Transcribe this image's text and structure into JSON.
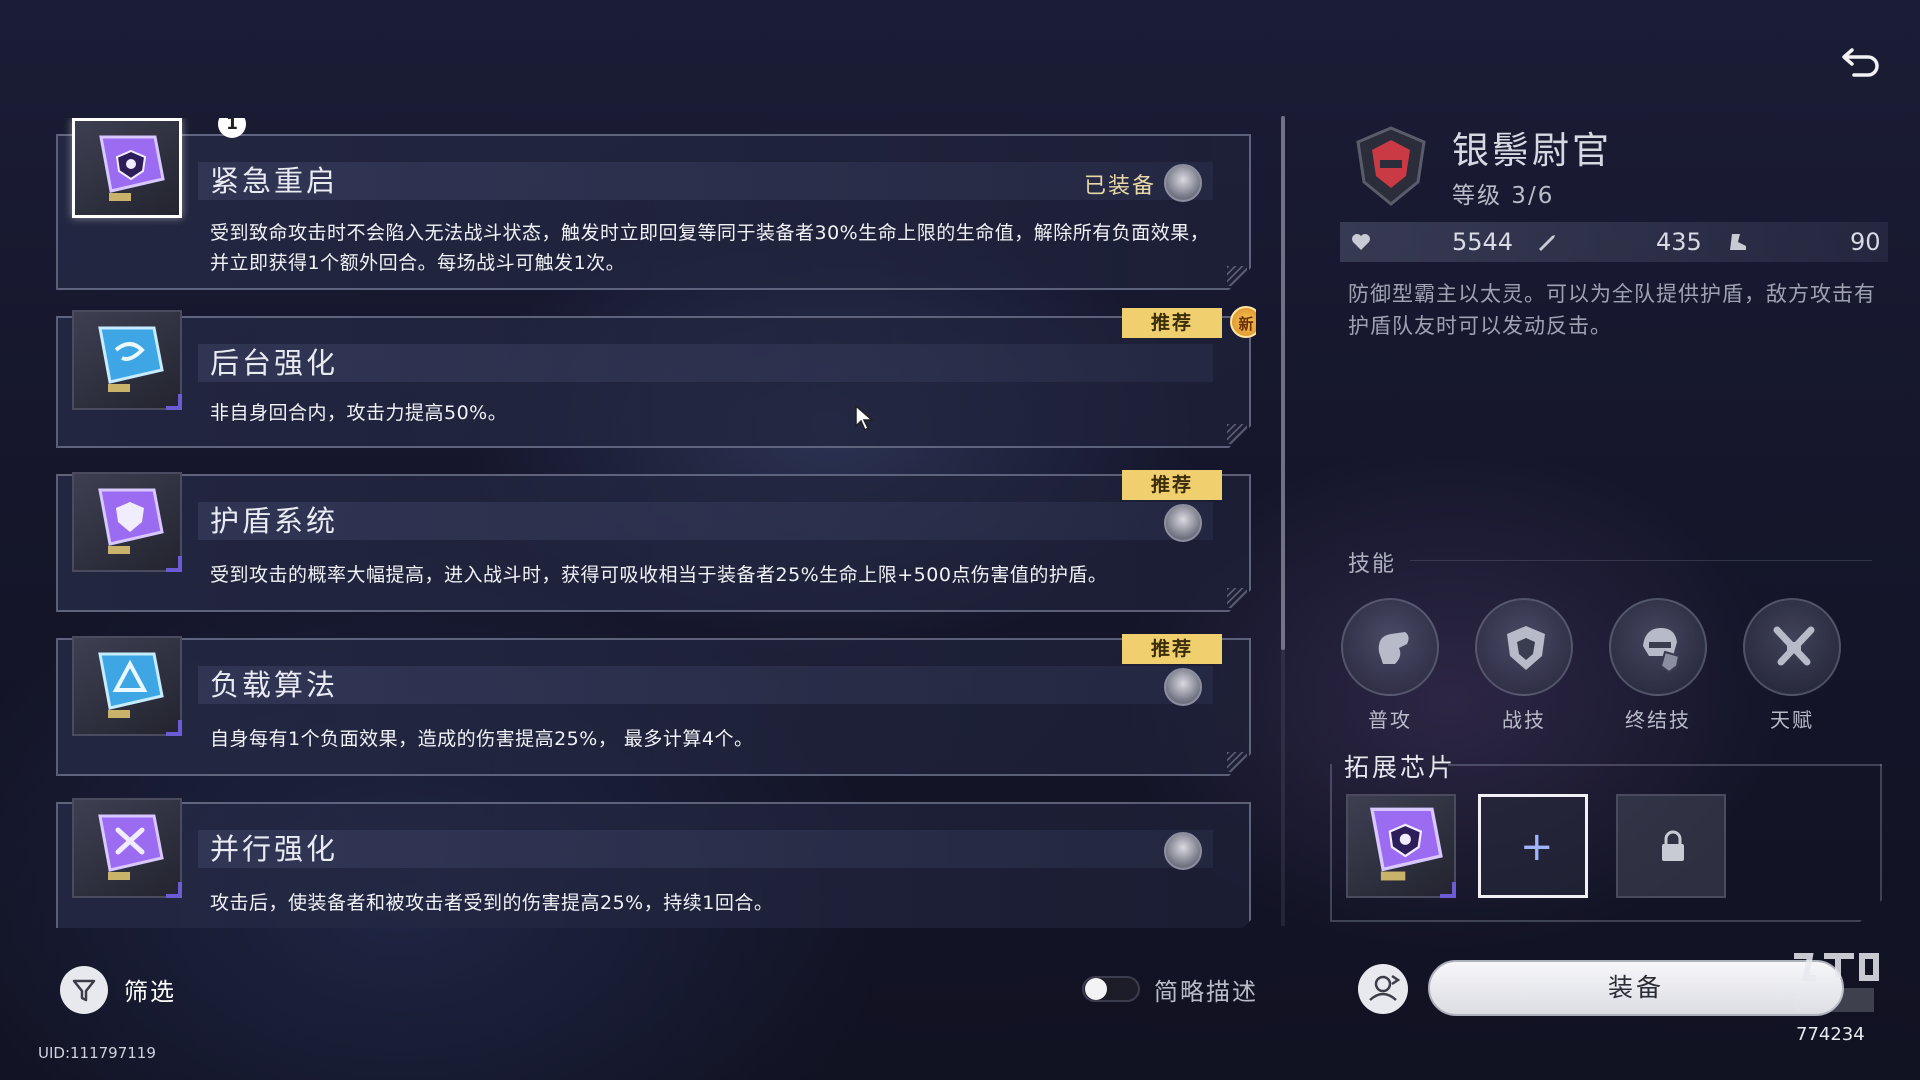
{
  "chips": [
    {
      "title": "紧急重启",
      "desc": "受到致命攻击时不会陷入无法战斗状态，触发时立即回复等同于装备者30%生命上限的生命值，解除所有负面效果，并立即获得1个额外回合。每场战斗可触发1次。",
      "badge": "1",
      "equipped_label": "已装备",
      "selected": true,
      "icon": "shield-heart-chip-icon",
      "color": "#9b6cf2"
    },
    {
      "title": "后台强化",
      "desc": "非自身回合内，攻击力提高50%。",
      "tag": "推荐",
      "new_badge": "新",
      "icon": "swirl-chip-icon",
      "color": "#3fa6e6"
    },
    {
      "title": "护盾系统",
      "desc": "受到攻击的概率大幅提高，进入战斗时，获得可吸收相当于装备者25%生命上限+500点伤害值的护盾。",
      "tag": "推荐",
      "icon": "shield-chip-icon",
      "color": "#9b6cf2"
    },
    {
      "title": "负载算法",
      "desc": "自身每有1个负面效果，造成的伤害提高25%， 最多计算4个。",
      "tag": "推荐",
      "icon": "triangle-chip-icon",
      "color": "#3fa6e6"
    },
    {
      "title": "并行强化",
      "desc": "攻击后，使装备者和被攻击者受到的伤害提高25%，持续1回合。",
      "icon": "cross-chip-icon",
      "color": "#9b6cf2"
    }
  ],
  "filter_label": "筛选",
  "brief_label": "简略描述",
  "uid": "UID:111797119",
  "character": {
    "name": "银鬃尉官",
    "level": "等级 3/6",
    "hp": "5544",
    "atk": "435",
    "spd": "90",
    "desc": "防御型霸主以太灵。可以为全队提供护盾，敌方攻击有护盾队友时可以发动反击。"
  },
  "skills_title": "技能",
  "skills": [
    {
      "label": "普攻",
      "icon": "fist-icon"
    },
    {
      "label": "战技",
      "icon": "shield-icon"
    },
    {
      "label": "终结技",
      "icon": "helmet-shield-icon"
    },
    {
      "label": "天赋",
      "icon": "crossed-swords-icon"
    }
  ],
  "ext_title": "拓展芯片",
  "equip_label": "装备",
  "watermark_id": "774234",
  "colors": {
    "tag": "#f0cf6e",
    "accent_purple": "#6b5cd6",
    "background": "#15162b"
  }
}
